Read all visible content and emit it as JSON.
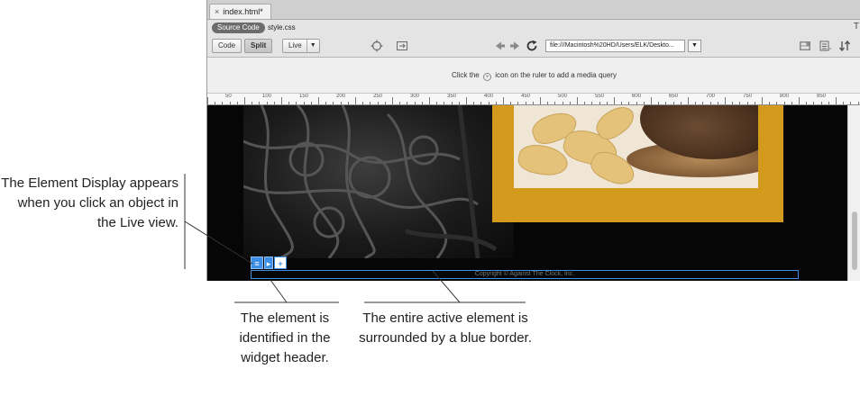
{
  "window": {
    "doc_tab": "index.html*",
    "close_glyph": "×",
    "source_code_label": "Source Code",
    "related_file": "style.css",
    "edge_glyph": "T"
  },
  "toolbar": {
    "code_label": "Code",
    "split_label": "Split",
    "live_label": "Live",
    "live_caret": "▼",
    "url": "file:///Macintosh%20HD/Users/ELK/Deskto...",
    "url_caret": "▼",
    "icons": [
      "inspect-icon",
      "sync-icon",
      "back-arrow-icon",
      "forward-arrow-icon",
      "refresh-icon",
      "multiscreen-icon",
      "options-icon"
    ]
  },
  "media_query_bar": {
    "before_icon": "Click the",
    "after_icon": "icon on the ruler to add a media query"
  },
  "ruler": {
    "labels": [
      "50",
      "100",
      "150",
      "200",
      "250",
      "300",
      "350",
      "400",
      "450",
      "500",
      "550",
      "600",
      "650",
      "700",
      "750",
      "800",
      "850"
    ]
  },
  "live_view": {
    "footer_text": "Copyright © Against The Clock, Inc.",
    "element_display": {
      "tag_glyph": "≡",
      "format_glyph": "▸",
      "add_glyph": "+"
    }
  },
  "callouts": {
    "left": "The Element Display appears when you click an object in the Live view.",
    "bottom_left": "The element is identified in the widget header.",
    "bottom_right": "The entire active element is surrounded by a blue border."
  },
  "colors": {
    "highlight_blue": "#3d8ee6",
    "gold": "#d49a1d",
    "callout_line": "#333333"
  }
}
